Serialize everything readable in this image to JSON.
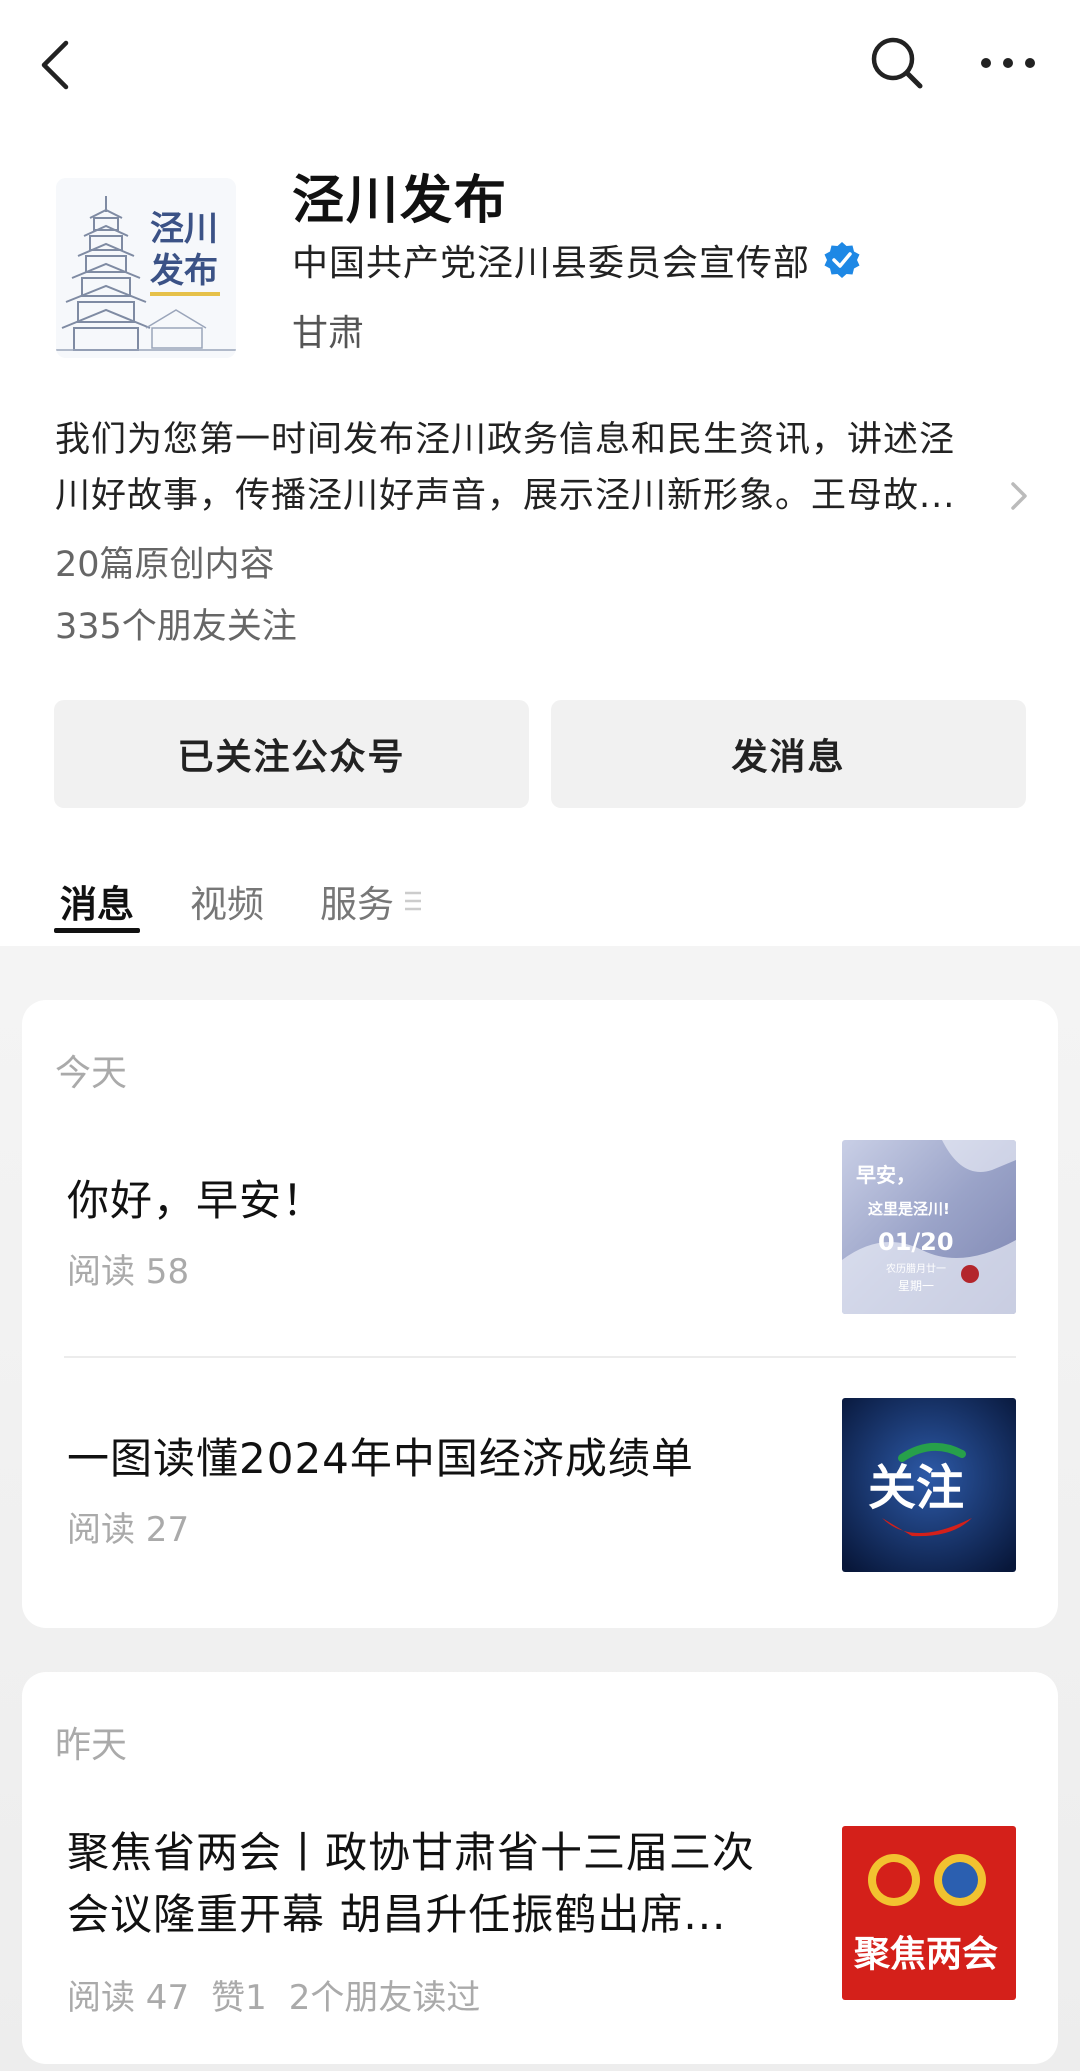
{
  "account": {
    "name": "泾川发布",
    "organization": "中国共产党泾川县委员会宣传部",
    "region": "甘肃",
    "logo_text_1": "泾川",
    "logo_text_2": "发布"
  },
  "description": {
    "line1": "我们为您第一时间发布泾川政务信息和民生资讯，讲述泾",
    "line2": "川好故事，传播泾川好声音，展示泾川新形象。王母故..."
  },
  "stats": {
    "original": "20篇原创内容",
    "friends": "335个朋友关注"
  },
  "buttons": {
    "follow": "已关注公众号",
    "message": "发消息"
  },
  "tabs": [
    {
      "label": "消息"
    },
    {
      "label": "视频"
    },
    {
      "label": "服务"
    }
  ],
  "feed": {
    "today": {
      "label": "今天",
      "articles": [
        {
          "title": "你好，早安！",
          "read": "阅读 58",
          "thumb_text": {
            "l1": "早安，",
            "l2": "这里是泾川!",
            "date": "01/20",
            "sub": "农历腊月廿一",
            "week": "星期一"
          }
        },
        {
          "title": "一图读懂2024年中国经济成绩单",
          "read": "阅读 27",
          "thumb_text": "关注"
        }
      ]
    },
    "yesterday": {
      "label": "昨天",
      "articles": [
        {
          "title_line1": "聚焦省两会丨政协甘肃省十三届三次",
          "title_line2": "会议隆重开幕 胡昌升任振鹤出席...",
          "read": "阅读 47",
          "likes": "赞1",
          "friends": "2个朋友读过",
          "thumb_text": "聚焦两会"
        }
      ]
    }
  },
  "colors": {
    "verified_blue": "#1e88e5",
    "tab_active": "#111111",
    "muted": "#aaaaaa",
    "thumb_red": "#d4201a",
    "thumb_navy": "#0b2250"
  }
}
